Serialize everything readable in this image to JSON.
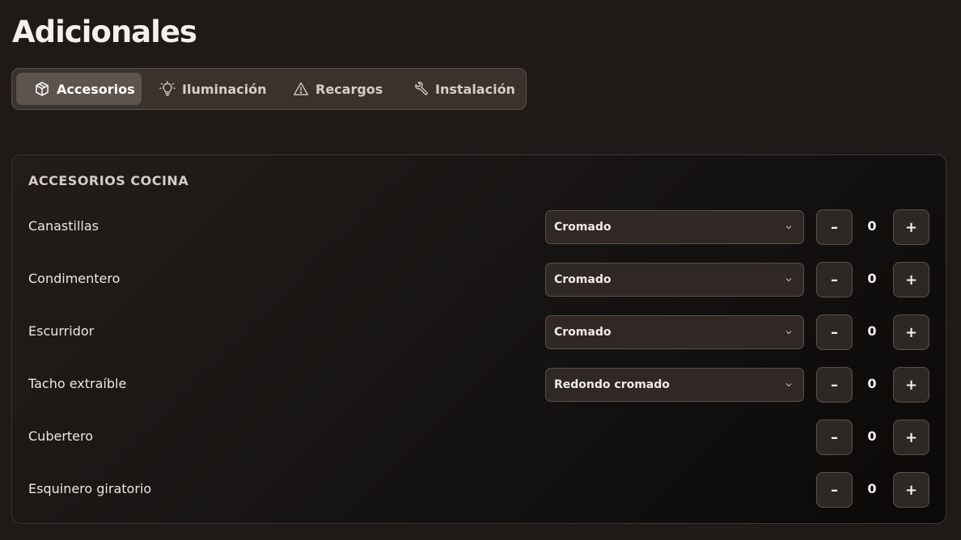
{
  "page": {
    "title": "Adicionales"
  },
  "tabs": [
    {
      "label": "Accesorios",
      "icon": "box-icon",
      "active": true
    },
    {
      "label": "Iluminación",
      "icon": "lightbulb-icon",
      "active": false
    },
    {
      "label": "Recargos",
      "icon": "warning-icon",
      "active": false
    },
    {
      "label": "Instalación",
      "icon": "wrench-icon",
      "active": false
    }
  ],
  "section": {
    "title": "ACCESORIOS COCINA",
    "rows": [
      {
        "label": "Canastillas",
        "select": "Cromado",
        "minus": "–",
        "qty": "0",
        "plus": "+"
      },
      {
        "label": "Condimentero",
        "select": "Cromado",
        "minus": "–",
        "qty": "0",
        "plus": "+"
      },
      {
        "label": "Escurridor",
        "select": "Cromado",
        "minus": "–",
        "qty": "0",
        "plus": "+"
      },
      {
        "label": "Tacho extraíble",
        "select": "Redondo cromado",
        "minus": "–",
        "qty": "0",
        "plus": "+"
      },
      {
        "label": "Cubertero",
        "select": null,
        "minus": "–",
        "qty": "0",
        "plus": "+"
      },
      {
        "label": "Esquinero giratorio",
        "select": null,
        "minus": "–",
        "qty": "0",
        "plus": "+"
      }
    ]
  }
}
